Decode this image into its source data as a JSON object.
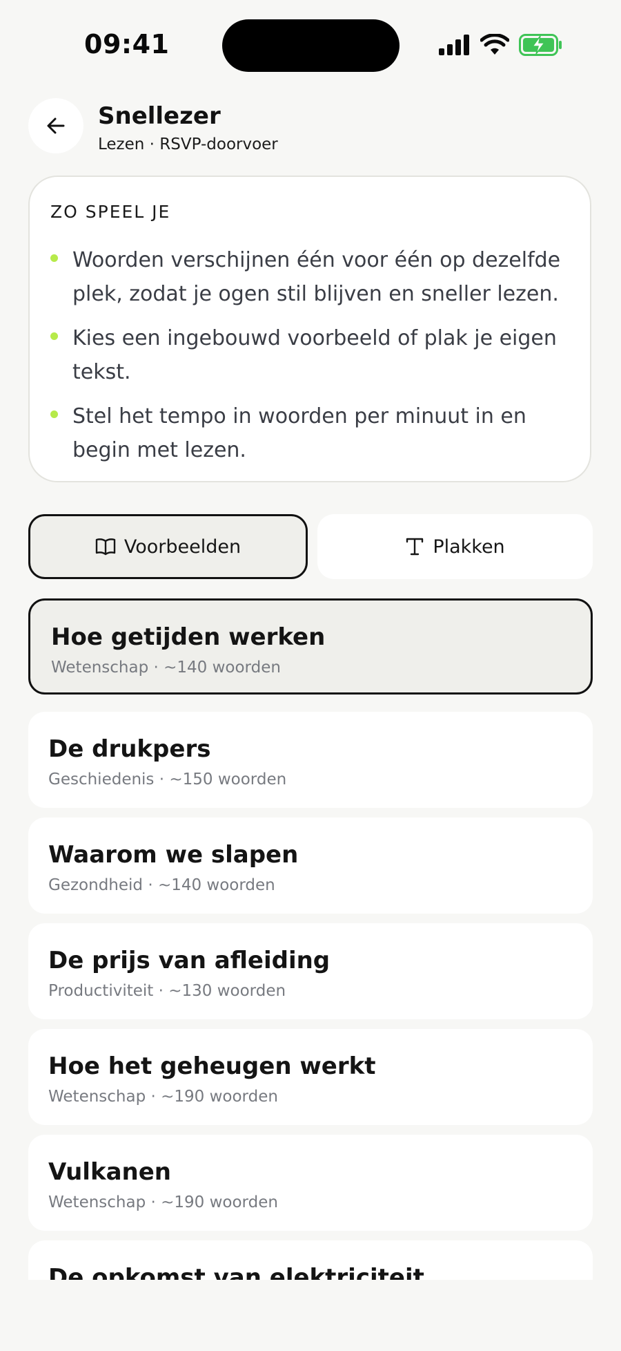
{
  "status_bar": {
    "time": "09:41"
  },
  "header": {
    "title": "Snellezer",
    "subtitle": "Lezen · RSVP-doorvoer"
  },
  "howto": {
    "heading": "ZO SPEEL JE",
    "items": [
      "Woorden verschijnen één voor één op dezelfde plek, zodat je ogen stil blijven en sneller lezen.",
      "Kies een ingebouwd voorbeeld of plak je eigen tekst.",
      "Stel het tempo in woorden per minuut in en begin met lezen."
    ],
    "bullet_color": "#b6ea4a"
  },
  "tabs": {
    "examples_label": "Voorbeelden",
    "paste_label": "Plakken",
    "active": "examples"
  },
  "examples": [
    {
      "title": "Hoe getijden werken",
      "meta": "Wetenschap · ~140 woorden",
      "selected": true
    },
    {
      "title": "De drukpers",
      "meta": "Geschiedenis · ~150 woorden",
      "selected": false
    },
    {
      "title": "Waarom we slapen",
      "meta": "Gezondheid · ~140 woorden",
      "selected": false
    },
    {
      "title": "De prijs van afleiding",
      "meta": "Productiviteit · ~130 woorden",
      "selected": false
    },
    {
      "title": "Hoe het geheugen werkt",
      "meta": "Wetenschap · ~190 woorden",
      "selected": false
    },
    {
      "title": "Vulkanen",
      "meta": "Wetenschap · ~190 woorden",
      "selected": false
    },
    {
      "title": "De opkomst van elektriciteit",
      "meta": "",
      "selected": false
    }
  ],
  "icons": {
    "back": "arrow-left-icon",
    "examples_tab": "book-open-icon",
    "paste_tab": "type-icon"
  },
  "colors": {
    "background": "#f7f7f5",
    "selected_fill": "#efefeb",
    "battery_green": "#3fc456"
  }
}
